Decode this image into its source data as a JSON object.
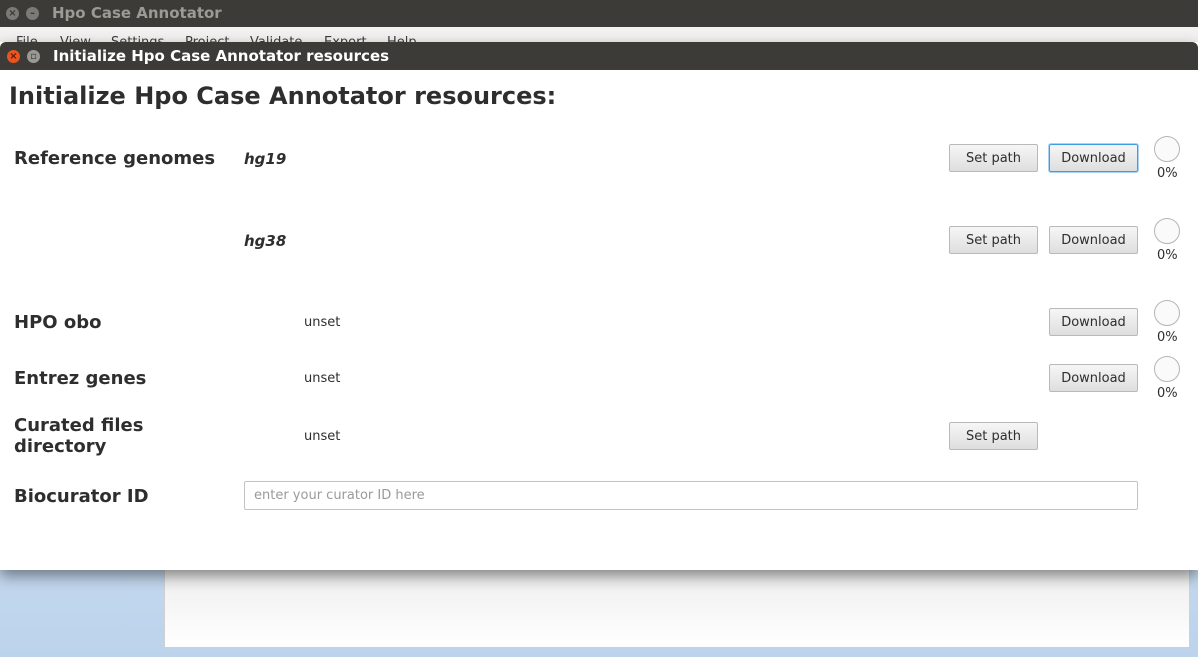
{
  "main_window": {
    "title": "Hpo Case Annotator",
    "menu": [
      "File",
      "View",
      "Settings",
      "Project",
      "Validate",
      "Export",
      "Help"
    ]
  },
  "dialog": {
    "title": "Initialize Hpo Case Annotator resources",
    "heading": "Initialize Hpo Case Annotator resources:",
    "reference_genomes": {
      "label": "Reference genomes",
      "hg19": {
        "name": "hg19",
        "set_path_label": "Set path",
        "download_label": "Download",
        "progress": "0%"
      },
      "hg38": {
        "name": "hg38",
        "set_path_label": "Set path",
        "download_label": "Download",
        "progress": "0%"
      }
    },
    "hpo_obo": {
      "label": "HPO obo",
      "value": "unset",
      "download_label": "Download",
      "progress": "0%"
    },
    "entrez_genes": {
      "label": "Entrez genes",
      "value": "unset",
      "download_label": "Download",
      "progress": "0%"
    },
    "curated_files": {
      "label_line1": "Curated files",
      "label_line2": "directory",
      "value": "unset",
      "set_path_label": "Set path"
    },
    "biocurator": {
      "label": "Biocurator ID",
      "placeholder": "enter your curator ID here",
      "value": ""
    }
  },
  "icons": {
    "main_close": "close-icon",
    "main_minimize": "minimize-icon",
    "dialog_close": "close-icon",
    "dialog_minimize": "minimize-icon"
  },
  "colors": {
    "titlebar": "#3c3b37",
    "close_button": "#e95420",
    "focus_ring": "#3d9ee5"
  }
}
